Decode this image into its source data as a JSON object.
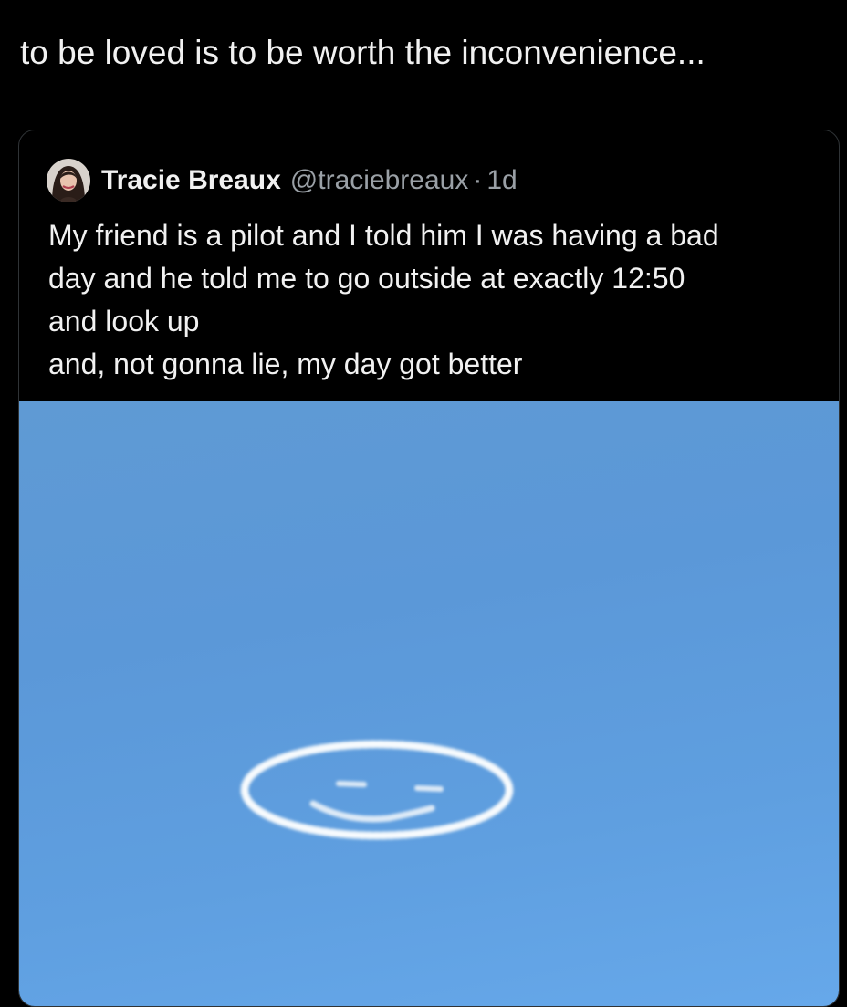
{
  "tweet": {
    "text": "to be loved is to be worth the inconvenience..."
  },
  "quoted_tweet": {
    "author_name": "Tracie Breaux",
    "handle": "@traciebreaux",
    "separator": "·",
    "time": "1d",
    "lines": [
      "My friend is a pilot and I told him I was having a bad",
      "day and he told me to go outside at exactly 12:50",
      "and look up",
      "and, not gonna lie, my day got better"
    ],
    "avatar_icon": "profile-photo",
    "photo_icon": "skywriting-smiley-face"
  },
  "colors": {
    "background": "#000000",
    "text": "#f1f1f1",
    "muted": "#9aa0a6",
    "sky": "#5f9ad4",
    "smoke": "#ffffff"
  }
}
